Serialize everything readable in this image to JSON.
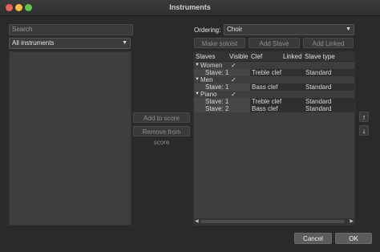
{
  "window": {
    "title": "Instruments"
  },
  "left": {
    "search_placeholder": "Search",
    "category": "All instruments"
  },
  "middle": {
    "add_label": "Add to score",
    "remove_label": "Remove from score"
  },
  "right": {
    "ordering_label": "Ordering:",
    "ordering_value": "Choir",
    "make_soloist": "Make soloist",
    "add_stave": "Add Stave",
    "add_linked_stave": "Add Linked Stave",
    "columns": [
      "Staves",
      "Visible",
      "Clef",
      "Linked",
      "Stave type"
    ],
    "groups": [
      {
        "name": "Women",
        "visible": "✓",
        "staves": [
          {
            "name": "Stave: 1",
            "clef": "Treble clef",
            "type": "Standard"
          }
        ]
      },
      {
        "name": "Men",
        "visible": "✓",
        "staves": [
          {
            "name": "Stave: 1",
            "clef": "Bass clef",
            "type": "Standard"
          }
        ]
      },
      {
        "name": "Piano",
        "visible": "✓",
        "staves": [
          {
            "name": "Stave: 1",
            "clef": "Treble clef",
            "type": "Standard"
          },
          {
            "name": "Stave: 2",
            "clef": "Bass clef",
            "type": "Standard"
          }
        ]
      }
    ],
    "move_up": "↑",
    "move_down": "↓"
  },
  "footer": {
    "cancel": "Cancel",
    "ok": "OK"
  },
  "colors": {
    "primary_button": "#2f63b5"
  }
}
